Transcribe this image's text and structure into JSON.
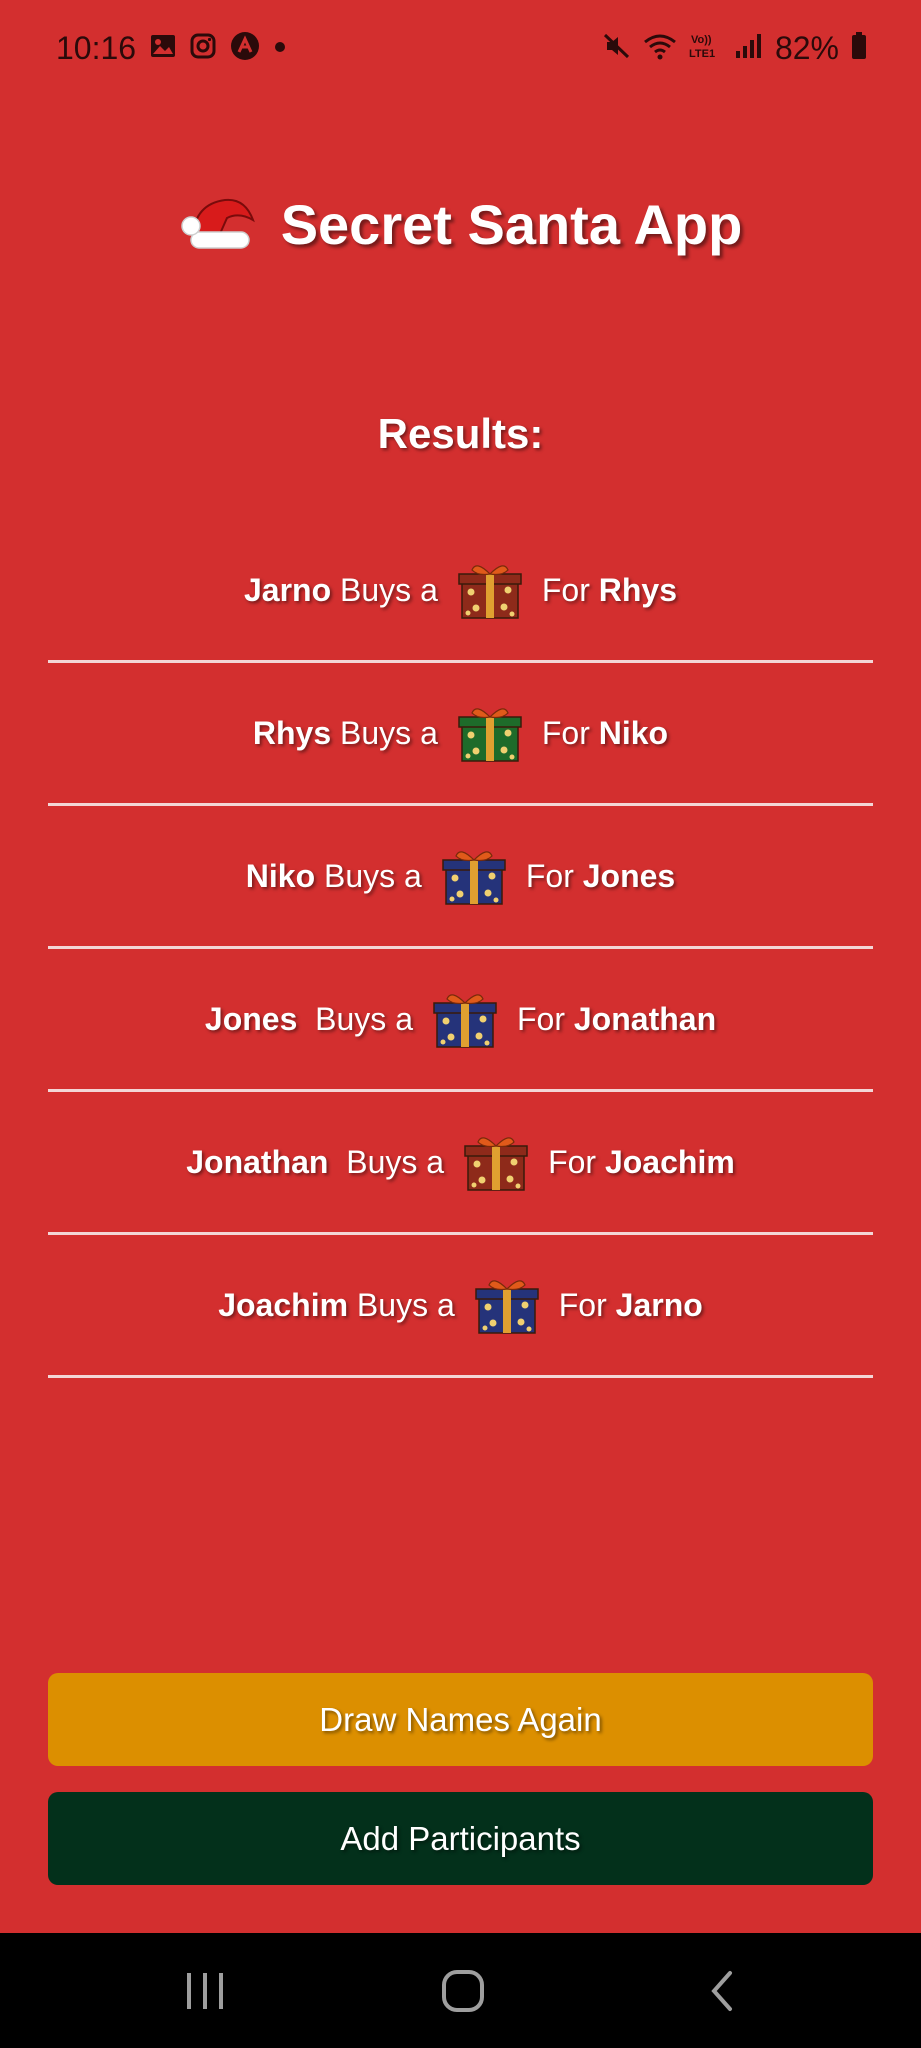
{
  "status_bar": {
    "time": "10:16",
    "notification_icons": [
      "gallery-icon",
      "instagram-icon",
      "app-icon",
      "dot-icon"
    ],
    "system_icons": [
      "mute-icon",
      "wifi-icon",
      "volte-icon",
      "signal-icon"
    ],
    "battery_text": "82%"
  },
  "header": {
    "title": "Secret Santa App",
    "icon": "santa-hat-icon"
  },
  "results": {
    "heading": "Results:",
    "rows": [
      {
        "giver": "Jarno",
        "buys_text": " Buys a",
        "gift_color": "#8e2a1a",
        "for_text": "For ",
        "receiver": "Rhys"
      },
      {
        "giver": "Rhys",
        "buys_text": " Buys a",
        "gift_color": "#1e6b2a",
        "for_text": "For ",
        "receiver": "Niko"
      },
      {
        "giver": "Niko",
        "buys_text": " Buys a",
        "gift_color": "#25337a",
        "for_text": "For ",
        "receiver": "Jones"
      },
      {
        "giver": "Jones",
        "buys_text": "  Buys a",
        "gift_color": "#25337a",
        "for_text": "For ",
        "receiver": "Jonathan"
      },
      {
        "giver": "Jonathan",
        "buys_text": "  Buys a",
        "gift_color": "#8e2a1a",
        "for_text": "For ",
        "receiver": "Joachim"
      },
      {
        "giver": "Joachim",
        "buys_text": " Buys a",
        "gift_color": "#25337a",
        "for_text": "For ",
        "receiver": "Jarno"
      }
    ]
  },
  "buttons": {
    "draw_again": "Draw Names Again",
    "add_participants": "Add Participants"
  },
  "colors": {
    "background": "#d32f2f",
    "draw_button": "#dc8f00",
    "add_button": "#03301b"
  },
  "nav_bar": {
    "items": [
      "recent-apps-icon",
      "home-icon",
      "back-icon"
    ]
  }
}
